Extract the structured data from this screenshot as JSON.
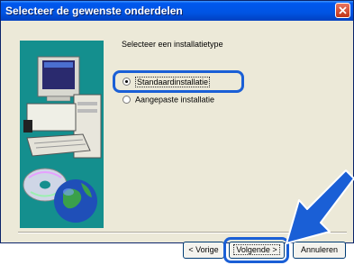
{
  "window": {
    "title": "Selecteer de gewenste onderdelen"
  },
  "prompt": "Selecteer een installatietype",
  "options": [
    {
      "label": "Standaardinstallatie",
      "selected": true
    },
    {
      "label": "Aangepaste installatie",
      "selected": false
    }
  ],
  "buttons": {
    "back": "< Vorige",
    "next": "Volgende >",
    "cancel": "Annuleren"
  },
  "colors": {
    "titlebar": "#0054e3",
    "highlight": "#1a5fd6",
    "illustration_bg": "#148f8e"
  },
  "icons": {
    "close": "close-icon",
    "illustration": "computer-with-cd-and-globe"
  }
}
